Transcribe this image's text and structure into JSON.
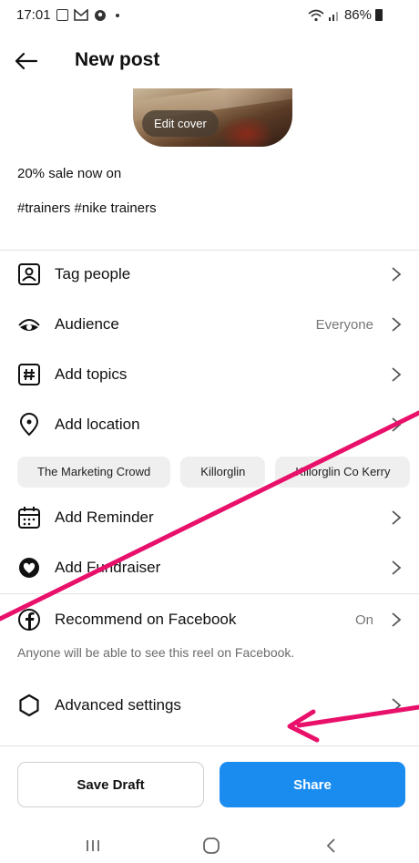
{
  "status_bar": {
    "time": "17:01",
    "battery": "86%"
  },
  "header": {
    "title": "New post"
  },
  "cover": {
    "edit_label": "Edit cover"
  },
  "caption": {
    "line1": "20% sale now on",
    "line2": "#trainers #nike trainers"
  },
  "options": [
    {
      "label": "Tag people",
      "icon": "tag-people-icon"
    },
    {
      "label": "Audience",
      "value": "Everyone",
      "icon": "audience-icon"
    },
    {
      "label": "Add topics",
      "icon": "hashtag-icon"
    },
    {
      "label": "Add location",
      "icon": "location-pin-icon"
    },
    {
      "label": "Add Reminder",
      "icon": "calendar-icon"
    },
    {
      "label": "Add Fundraiser",
      "icon": "fundraiser-icon"
    },
    {
      "label": "Recommend on Facebook",
      "value": "On",
      "icon": "facebook-icon"
    },
    {
      "label": "Advanced settings",
      "icon": "gear-icon"
    }
  ],
  "location_chips": [
    "The Marketing Crowd",
    "Killorglin",
    "Killorglin Co Kerry"
  ],
  "facebook_note": "Anyone will be able to see this reel on Facebook.",
  "actions": {
    "save_draft": "Save Draft",
    "share": "Share"
  },
  "colors": {
    "accent": "#1a8cf0",
    "annotation": "#e8106a"
  }
}
